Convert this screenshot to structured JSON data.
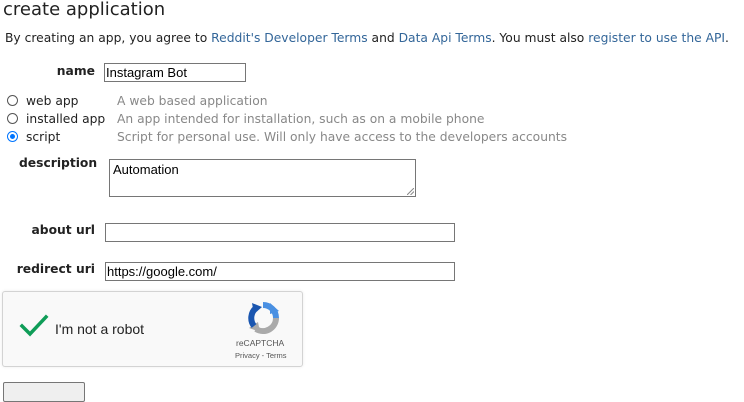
{
  "page": {
    "title": "create application"
  },
  "intro": {
    "prefix": "By creating an app, you agree to ",
    "link1": "Reddit's Developer Terms",
    "middle": " and ",
    "link2": "Data Api Terms",
    "suffix": ". You must also ",
    "link3": "register to use the API",
    "end": "."
  },
  "form": {
    "name_label": "name",
    "name_value": "Instagram Bot",
    "app_types": [
      {
        "label": "web app",
        "description": "A web based application",
        "selected": false
      },
      {
        "label": "installed app",
        "description": "An app intended for installation, such as on a mobile phone",
        "selected": false
      },
      {
        "label": "script",
        "description": "Script for personal use. Will only have access to the developers accounts",
        "selected": true
      }
    ],
    "description_label": "description",
    "description_value": "Automation",
    "about_url_label": "about url",
    "about_url_value": "",
    "redirect_uri_label": "redirect uri",
    "redirect_uri_value": "https://google.com/"
  },
  "captcha": {
    "text": "I'm not a robot",
    "checked": true,
    "brand": "reCAPTCHA",
    "links": "Privacy - Terms",
    "check_color": "#0f9d58"
  },
  "colors": {
    "link": "#336699",
    "muted": "#888888",
    "radio_selected": "#0075ff"
  }
}
